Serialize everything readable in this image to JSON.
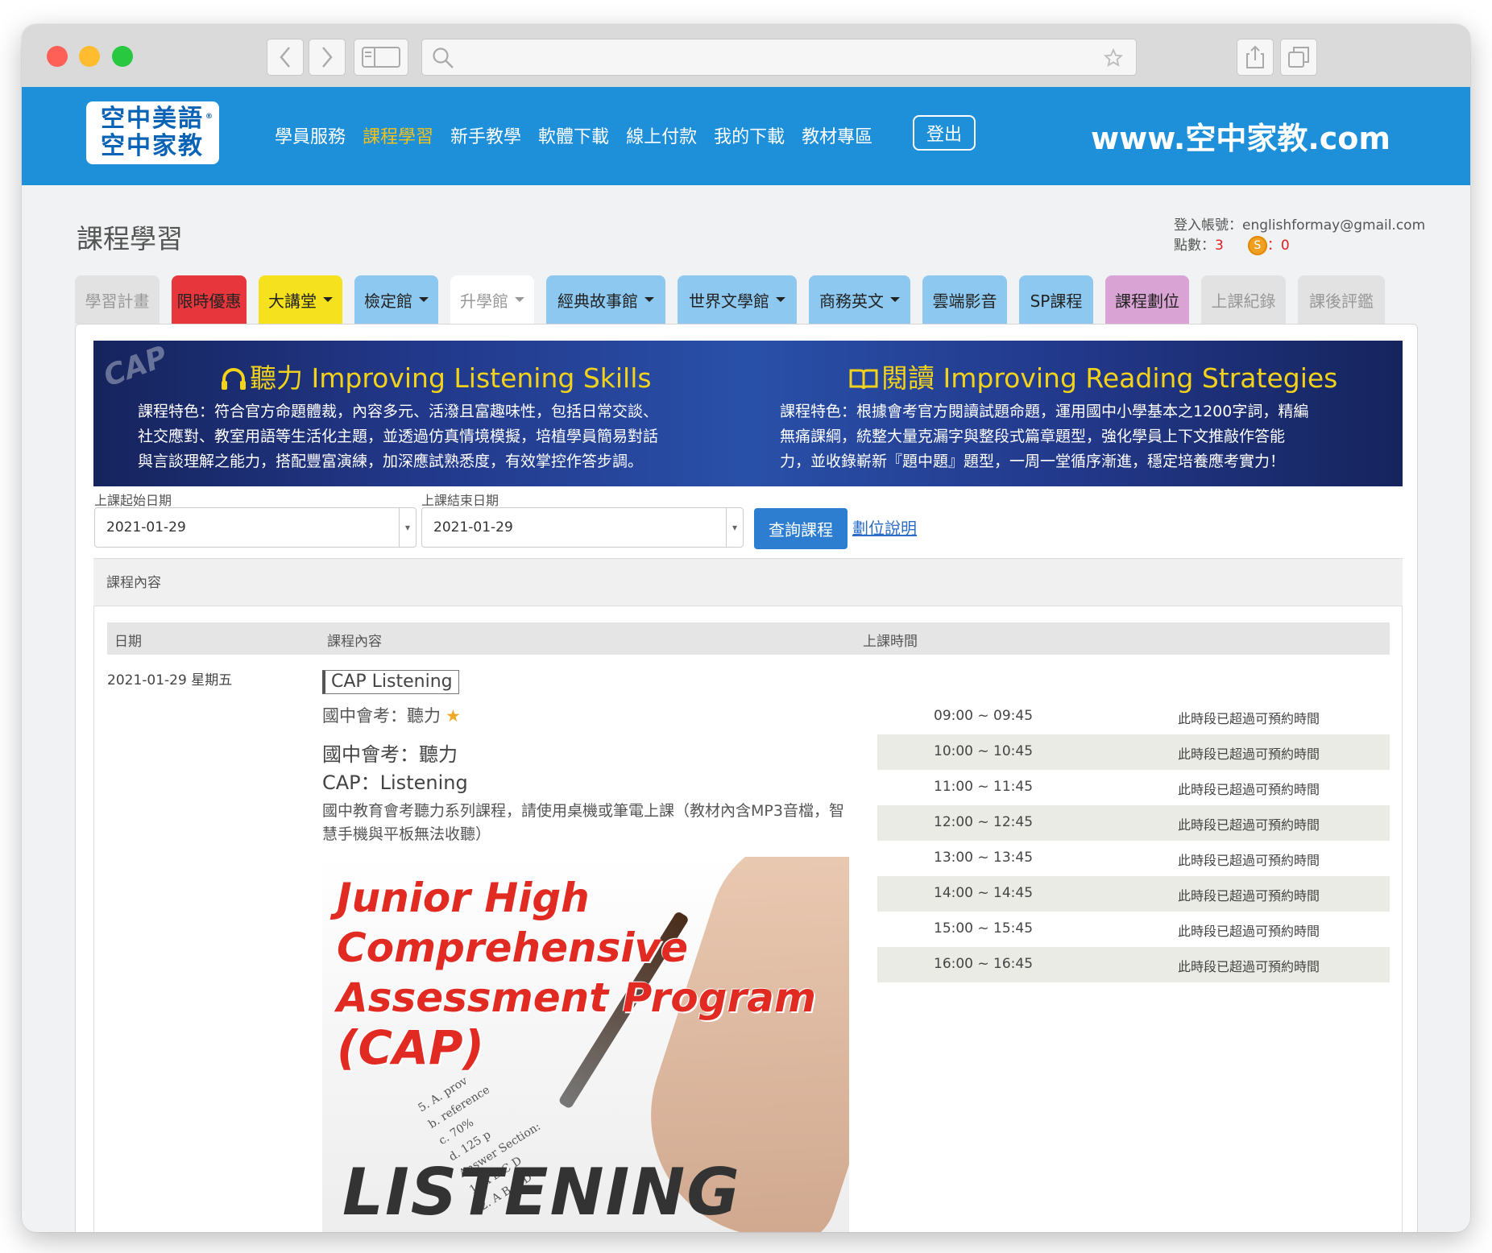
{
  "site": {
    "logo_line1": "空中美語",
    "logo_line2": "空中家教",
    "logo_mark": "®",
    "nav": [
      {
        "label": "學員服務",
        "active": false
      },
      {
        "label": "課程學習",
        "active": true
      },
      {
        "label": "新手教學",
        "active": false
      },
      {
        "label": "軟體下載",
        "active": false
      },
      {
        "label": "線上付款",
        "active": false
      },
      {
        "label": "我的下載",
        "active": false
      },
      {
        "label": "教材專區",
        "active": false
      }
    ],
    "logout_label": "登出",
    "url_text": "www.空中家教.com",
    "brand_color": "#1e8fd9",
    "active_color": "#f3c21a"
  },
  "page": {
    "title": "課程學習",
    "account_label": "登入帳號：",
    "account_email": "englishformay@gmail.com",
    "points_label": "點數：",
    "points_value": "3",
    "coin_icon_text": "S",
    "coin_value": "0"
  },
  "tabs": [
    {
      "label": "學習計畫",
      "dropdown": false,
      "bg": "#e2e2e2",
      "fg": "#999999"
    },
    {
      "label": "限時優惠",
      "dropdown": false,
      "bg": "#e8373c",
      "fg": "#222222"
    },
    {
      "label": "大講堂",
      "dropdown": true,
      "bg": "#f5e11e",
      "fg": "#222222"
    },
    {
      "label": "檢定館",
      "dropdown": true,
      "bg": "#8cc8f0",
      "fg": "#222222"
    },
    {
      "label": "升學館",
      "dropdown": true,
      "bg": "#ffffff",
      "fg": "#999999"
    },
    {
      "label": "經典故事館",
      "dropdown": true,
      "bg": "#8cc8f0",
      "fg": "#222222"
    },
    {
      "label": "世界文學館",
      "dropdown": true,
      "bg": "#8cc8f0",
      "fg": "#222222"
    },
    {
      "label": "商務英文",
      "dropdown": true,
      "bg": "#8cc8f0",
      "fg": "#222222"
    },
    {
      "label": "雲端影音",
      "dropdown": false,
      "bg": "#8cc8f0",
      "fg": "#222222"
    },
    {
      "label": "SP課程",
      "dropdown": false,
      "bg": "#8cc8f0",
      "fg": "#222222"
    },
    {
      "label": "課程劃位",
      "dropdown": false,
      "bg": "#d9a3d3",
      "fg": "#222222"
    },
    {
      "label": "上課紀錄",
      "dropdown": false,
      "bg": "#e2e2e2",
      "fg": "#999999"
    },
    {
      "label": "課後評鑑",
      "dropdown": false,
      "bg": "#e2e2e2",
      "fg": "#999999"
    }
  ],
  "banner": {
    "watermark": "CAP",
    "listening_title": "聽力 Improving Listening Skills",
    "listening_lines": [
      "課程特色：符合官方命題體裁，內容多元、活潑且富趣味性，包括日常交談、",
      "社交應對、教室用語等生活化主題，並透過仿真情境模擬，培植學員簡易對話",
      "與言談理解之能力，搭配豐富演練，加深應試熟悉度，有效掌控作答步調。"
    ],
    "reading_title": "閱讀 Improving Reading Strategies",
    "reading_lines": [
      "課程特色：根據會考官方閱讀試題命題，運用國中小學基本之1200字詞，精編",
      "無痛課綱，統整大量克漏字與整段式篇章題型，強化學員上下文推敲作答能",
      "力，並收錄嶄新『題中題』題型，一周一堂循序漸進，穩定培養應考實力！"
    ]
  },
  "filters": {
    "start_label": "上課起始日期",
    "start_value": "2021-01-29",
    "end_label": "上課結束日期",
    "end_value": "2021-01-29",
    "query_label": "查詢課程",
    "help_link": "劃位說明"
  },
  "course": {
    "section_label": "課程內容",
    "columns": [
      "日期",
      "課程內容",
      "上課時間"
    ],
    "date": "2021-01-29 星期五",
    "tag": "CAP Listening",
    "subtitle": "國中會考：聽力",
    "title_zh": "國中會考：聽力",
    "title_en": "CAP：Listening",
    "description": "國中教育會考聽力系列課程，請使用桌機或筆電上課（教材內含MP3音檔，智慧手機與平板無法收聽）",
    "image": {
      "title_lines": [
        "Junior High",
        "Comprehensive",
        "Assessment Program",
        "(CAP)"
      ],
      "bottom_word": "LISTENING",
      "form_lines": [
        "5.   A. prov",
        "     b. reference",
        "     c. 70%",
        "     d. 125 p",
        "Answer Section:",
        "1.  A B C D",
        "2.  A B C D"
      ]
    },
    "slots": [
      {
        "time": "09:00 ~ 09:45",
        "status": "此時段已超過可預約時間"
      },
      {
        "time": "10:00 ~ 10:45",
        "status": "此時段已超過可預約時間"
      },
      {
        "time": "11:00 ~ 11:45",
        "status": "此時段已超過可預約時間"
      },
      {
        "time": "12:00 ~ 12:45",
        "status": "此時段已超過可預約時間"
      },
      {
        "time": "13:00 ~ 13:45",
        "status": "此時段已超過可預約時間"
      },
      {
        "time": "14:00 ~ 14:45",
        "status": "此時段已超過可預約時間"
      },
      {
        "time": "15:00 ~ 15:45",
        "status": "此時段已超過可預約時間"
      },
      {
        "time": "16:00 ~ 16:45",
        "status": "此時段已超過可預約時間"
      }
    ]
  }
}
